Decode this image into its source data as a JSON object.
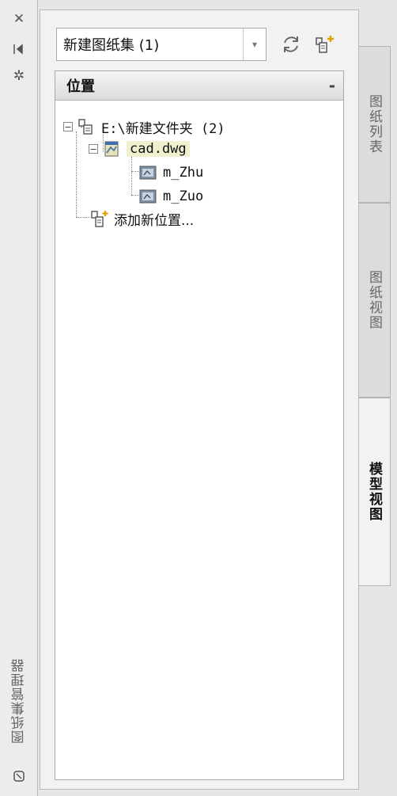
{
  "title_strip": {
    "close_icon": "close-icon",
    "autohide_icon": "auto-hide-icon",
    "properties_icon": "properties-icon",
    "title": "图纸集管理器",
    "bottom_icon": "palette-icon"
  },
  "toolbar": {
    "sheet_set_value": "新建图纸集 (1)",
    "refresh_icon": "refresh-icon",
    "model_view_icon": "add-location-icon"
  },
  "tree": {
    "header": "位置",
    "collapse": "-",
    "nodes": [
      {
        "label": "E:\\新建文件夹 (2)",
        "expander": "−"
      },
      {
        "label": "cad.dwg",
        "expander": "−"
      },
      {
        "label": "m_Zhu"
      },
      {
        "label": "m_Zuo"
      },
      {
        "label": "添加新位置..."
      }
    ]
  },
  "tabs": [
    {
      "label": "图纸列表"
    },
    {
      "label": "图纸视图"
    },
    {
      "label": "模型视图"
    }
  ]
}
